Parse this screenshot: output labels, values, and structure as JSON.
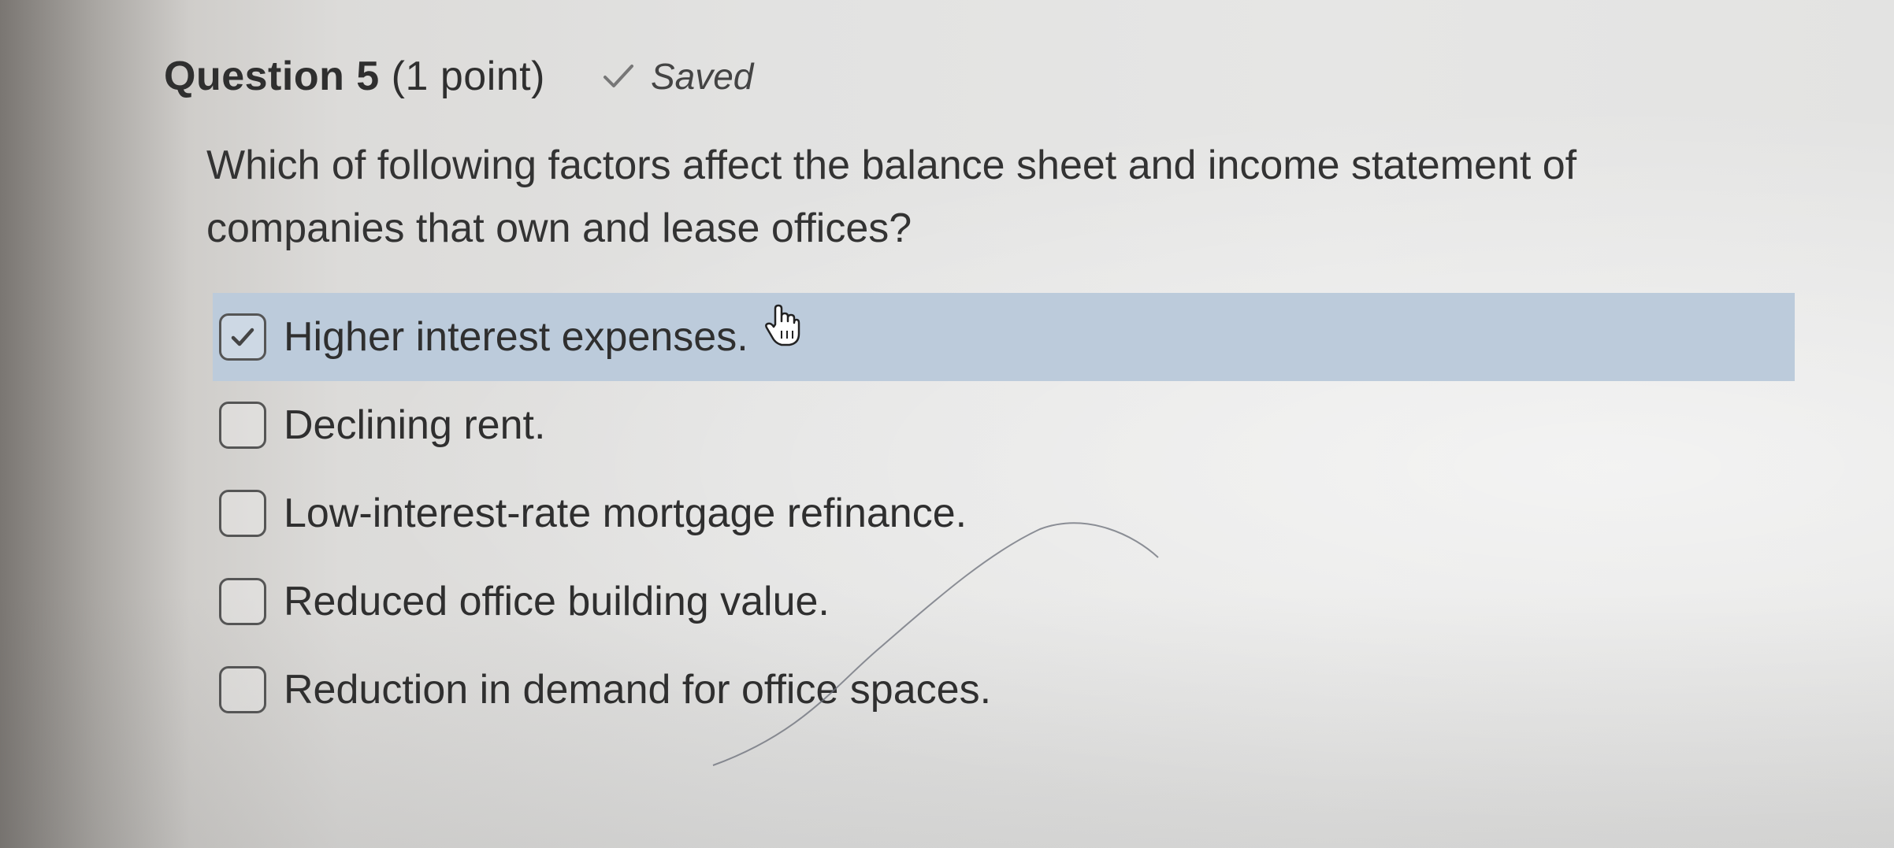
{
  "question": {
    "number_label": "Question 5",
    "points_label": "(1 point)",
    "status": {
      "icon": "check-icon",
      "label": "Saved"
    },
    "prompt": "Which of following factors affect the balance sheet and income statement of companies that own and lease offices?"
  },
  "options": [
    {
      "label": "Higher interest expenses.",
      "checked": true
    },
    {
      "label": "Declining rent.",
      "checked": false
    },
    {
      "label": "Low-interest-rate mortgage refinance.",
      "checked": false
    },
    {
      "label": "Reduced office building value.",
      "checked": false
    },
    {
      "label": "Reduction in demand for office spaces.",
      "checked": false
    }
  ],
  "colors": {
    "selected_row": "#bccbdb",
    "text": "#2f2f2f"
  }
}
